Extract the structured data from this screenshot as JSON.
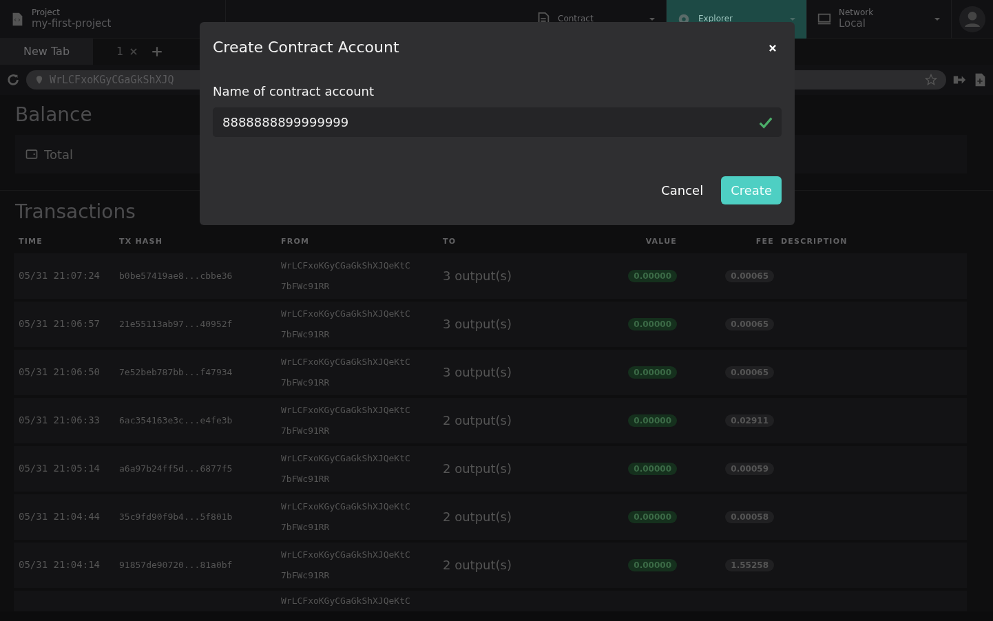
{
  "header": {
    "project": {
      "label": "Project",
      "value": "my-first-project"
    },
    "contract": {
      "label": "Contract"
    },
    "explorer": {
      "label": "Explorer",
      "selected": true
    },
    "network": {
      "label": "Network",
      "value": "Local"
    }
  },
  "tabs": [
    {
      "label": "New Tab",
      "selected": true
    },
    {
      "label": "1",
      "selected": false
    }
  ],
  "address_bar": {
    "value": "WrLCFxoKGyCGaGkShXJQ"
  },
  "balance": {
    "title": "Balance",
    "total_label": "Total"
  },
  "transactions": {
    "title": "Transactions",
    "columns": [
      "TIME",
      "TX HASH",
      "FROM",
      "TO",
      "VALUE",
      "FEE",
      "DESCRIPTION"
    ],
    "rows": [
      {
        "time": "05/31 21:07:24",
        "hash": "b0be57419ae8...cbbe36",
        "from": [
          "WrLCFxoKGyCGaGkShXJQeKtC",
          "7bFWc91RR"
        ],
        "to": "3 output(s)",
        "value": "0.00000",
        "fee": "0.00065"
      },
      {
        "time": "05/31 21:06:57",
        "hash": "21e55113ab97...40952f",
        "from": [
          "WrLCFxoKGyCGaGkShXJQeKtC",
          "7bFWc91RR"
        ],
        "to": "3 output(s)",
        "value": "0.00000",
        "fee": "0.00065"
      },
      {
        "time": "05/31 21:06:50",
        "hash": "7e52beb787bb...f47934",
        "from": [
          "WrLCFxoKGyCGaGkShXJQeKtC",
          "7bFWc91RR"
        ],
        "to": "3 output(s)",
        "value": "0.00000",
        "fee": "0.00065"
      },
      {
        "time": "05/31 21:06:33",
        "hash": "6ac354163e3c...e4fe3b",
        "from": [
          "WrLCFxoKGyCGaGkShXJQeKtC",
          "7bFWc91RR"
        ],
        "to": "2 output(s)",
        "value": "0.00000",
        "fee": "0.02911"
      },
      {
        "time": "05/31 21:05:14",
        "hash": "a6a97b24ff5d...6877f5",
        "from": [
          "WrLCFxoKGyCGaGkShXJQeKtC",
          "7bFWc91RR"
        ],
        "to": "2 output(s)",
        "value": "0.00000",
        "fee": "0.00059"
      },
      {
        "time": "05/31 21:04:44",
        "hash": "35c9fd90f9b4...5f801b",
        "from": [
          "WrLCFxoKGyCGaGkShXJQeKtC",
          "7bFWc91RR"
        ],
        "to": "2 output(s)",
        "value": "0.00000",
        "fee": "0.00058"
      },
      {
        "time": "05/31 21:04:14",
        "hash": "91857de90720...81a0bf",
        "from": [
          "WrLCFxoKGyCGaGkShXJQeKtC",
          "7bFWc91RR"
        ],
        "to": "2 output(s)",
        "value": "0.00000",
        "fee": "1.55258"
      },
      {
        "from": [
          "WrLCFxoKGyCGaGkShXJQeKtC"
        ]
      }
    ]
  },
  "modal": {
    "title": "Create Contract Account",
    "field_label": "Name of contract account",
    "value": "8888888899999999",
    "valid": true,
    "buttons": [
      {
        "label": "Cancel",
        "kind": "secondary"
      },
      {
        "label": "Create",
        "kind": "primary"
      }
    ]
  }
}
